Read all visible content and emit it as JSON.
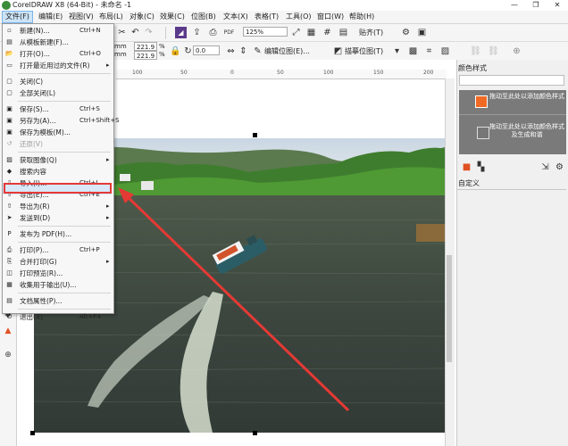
{
  "window": {
    "title": "CorelDRAW X8 (64-Bit) - 未命名 -1",
    "min": "—",
    "max": "❐",
    "close": "✕"
  },
  "menubar": [
    {
      "label": "文件(F)",
      "active": true
    },
    {
      "label": "编辑(E)"
    },
    {
      "label": "视图(V)"
    },
    {
      "label": "布局(L)"
    },
    {
      "label": "对象(C)"
    },
    {
      "label": "效果(C)"
    },
    {
      "label": "位图(B)"
    },
    {
      "label": "文本(X)"
    },
    {
      "label": "表格(T)"
    },
    {
      "label": "工具(O)"
    },
    {
      "label": "窗口(W)"
    },
    {
      "label": "帮助(H)"
    }
  ],
  "toolbar": {
    "zoom": "125%",
    "snap": "贴齐(T)",
    "width_unit": "mm",
    "height_unit": "mm",
    "scale_x": "221.9",
    "scale_y": "221.9",
    "percent": "%",
    "rotation": "0.0",
    "edit_bitmap": "编辑位图(E)...",
    "trace_bitmap": "描摹位图(T)"
  },
  "ruler": {
    "ticks": [
      "100",
      "50",
      "0",
      "50",
      "100",
      "150",
      "200"
    ]
  },
  "file_menu": {
    "items": [
      {
        "icon": "new-icon",
        "label": "新建(N)...",
        "shortcut": "Ctrl+N"
      },
      {
        "icon": "template-icon",
        "label": "从模板新建(F)..."
      },
      {
        "icon": "open-icon",
        "label": "打开(O)...",
        "shortcut": "Ctrl+O"
      },
      {
        "icon": "recent-icon",
        "label": "打开最近用过的文件(R)",
        "submenu": true
      },
      {
        "sep": true
      },
      {
        "icon": "close-doc-icon",
        "label": "关闭(C)"
      },
      {
        "icon": "close-all-icon",
        "label": "全部关闭(L)"
      },
      {
        "sep": true
      },
      {
        "icon": "save-icon",
        "label": "保存(S)...",
        "shortcut": "Ctrl+S"
      },
      {
        "icon": "save-as-icon",
        "label": "另存为(A)...",
        "shortcut": "Ctrl+Shift+S"
      },
      {
        "icon": "save-template-icon",
        "label": "保存为模板(M)..."
      },
      {
        "icon": "revert-icon",
        "label": "还原(V)",
        "disabled": true
      },
      {
        "sep": true
      },
      {
        "icon": "acquire-icon",
        "label": "获取图像(Q)",
        "submenu": true
      },
      {
        "icon": "search-content-icon",
        "label": "搜索内容"
      },
      {
        "icon": "import-icon",
        "label": "导入(I)...",
        "shortcut": "Ctrl+I"
      },
      {
        "icon": "export-icon",
        "label": "导出(E)...",
        "shortcut": "Ctrl+E",
        "highlight": true
      },
      {
        "icon": "export-for-icon",
        "label": "导出为(R)",
        "submenu": true
      },
      {
        "icon": "send-to-icon",
        "label": "发送到(D)",
        "submenu": true
      },
      {
        "sep": true
      },
      {
        "icon": "pdf-icon",
        "label": "发布为 PDF(H)..."
      },
      {
        "sep": true
      },
      {
        "icon": "print-icon",
        "label": "打印(P)...",
        "shortcut": "Ctrl+P"
      },
      {
        "icon": "merge-print-icon",
        "label": "合并打印(G)",
        "submenu": true
      },
      {
        "icon": "print-preview-icon",
        "label": "打印预览(R)..."
      },
      {
        "icon": "collect-output-icon",
        "label": "收集用于输出(U)..."
      },
      {
        "sep": true
      },
      {
        "icon": "properties-icon",
        "label": "文档属性(P)..."
      },
      {
        "sep": true
      },
      {
        "icon": "exit-icon",
        "label": "退出(X)",
        "shortcut": "Alt+F4"
      }
    ]
  },
  "docker": {
    "title": "颜色样式",
    "swatch1_text": "拖动至此处以添加颜色样式",
    "swatch2_text": "拖动至此处以添加颜色样式及生成和谐",
    "custom_label": "自定义",
    "accent": "#f06a24"
  },
  "annotation": {
    "color": "#e53935"
  }
}
